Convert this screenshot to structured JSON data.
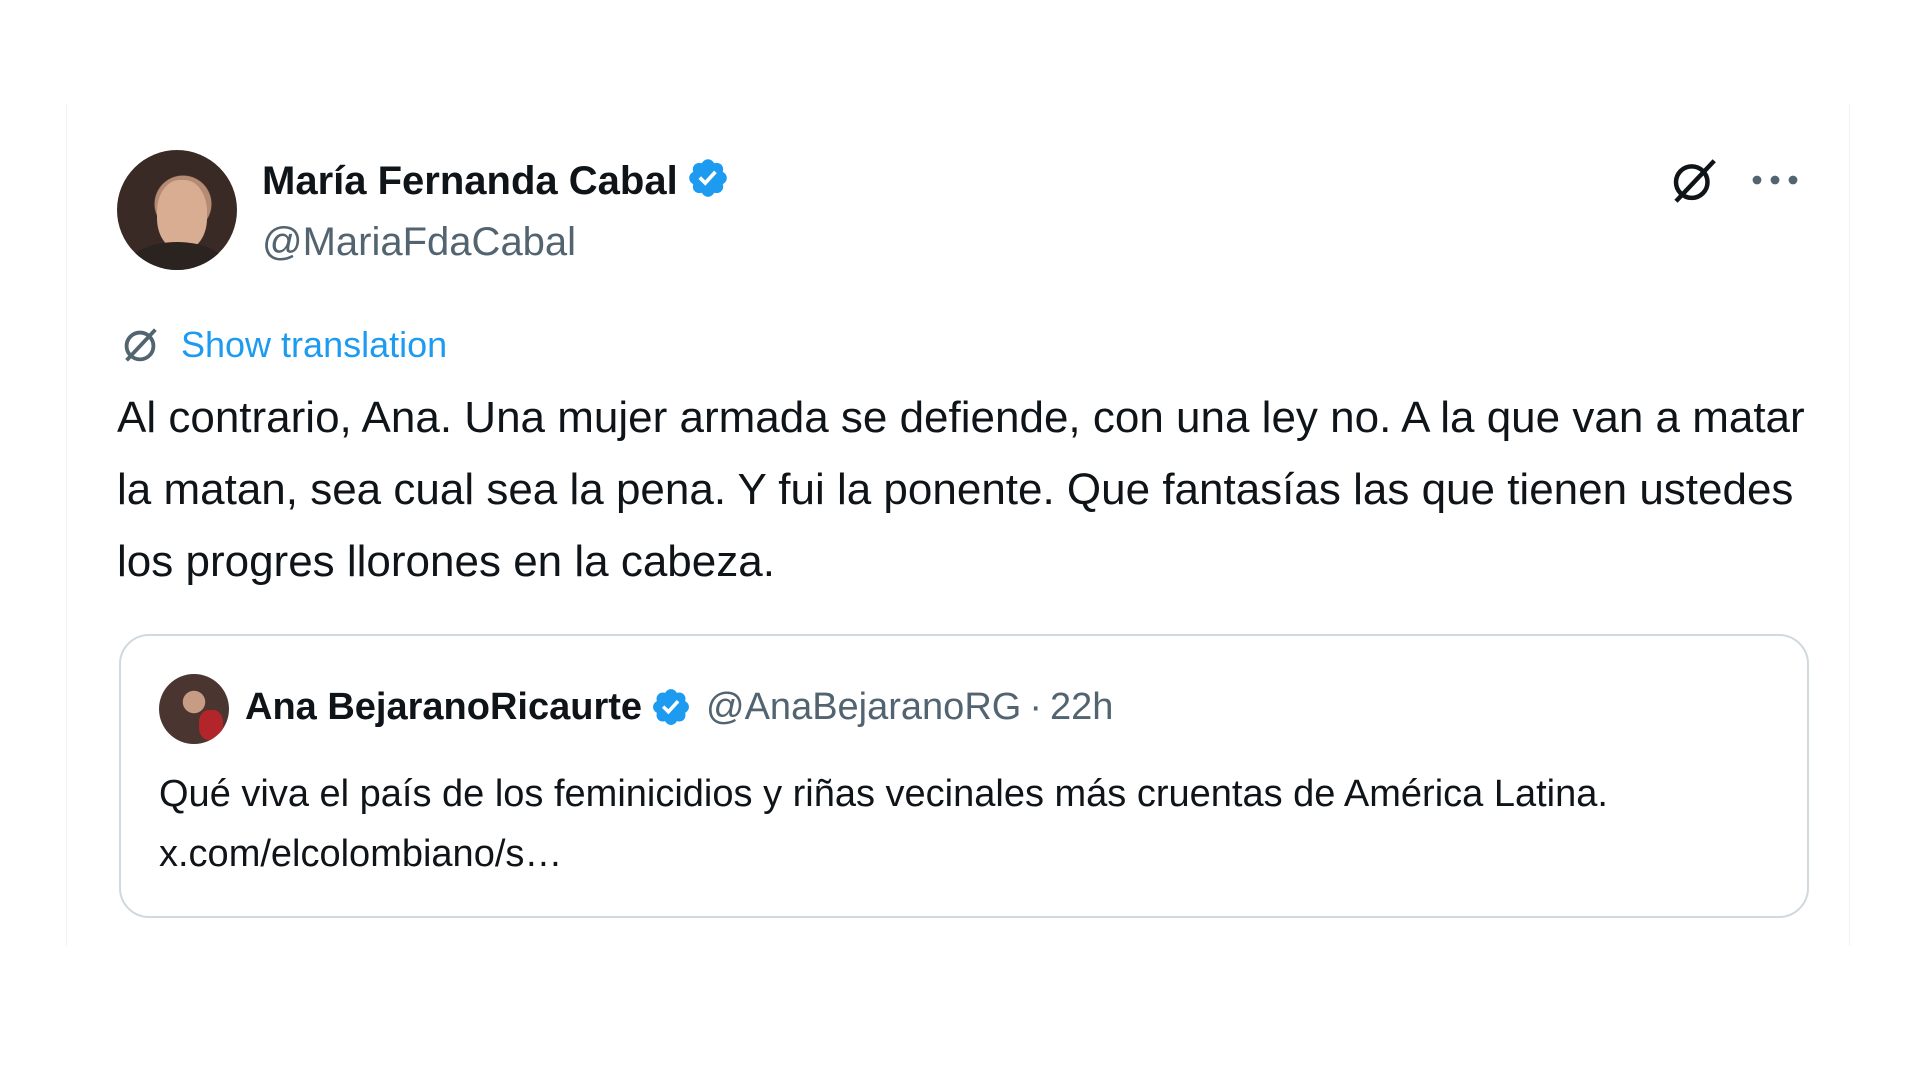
{
  "tweet": {
    "author": {
      "name": "María Fernanda Cabal",
      "handle": "@MariaFdaCabal",
      "verified": true
    },
    "translate_label": "Show translation",
    "text": "Al contrario, Ana. Una mujer armada se defiende, con una ley no. A la que van a matar la matan, sea cual sea la pena. Y fui la ponente. Que fantasías las que tienen ustedes los progres llorones en la cabeza."
  },
  "quote": {
    "author": {
      "name": "Ana BejaranoRicaurte",
      "handle": "@AnaBejaranoRG",
      "verified": true
    },
    "separator": "·",
    "time": "22h",
    "text": "Qué viva el país de los feminicidios y riñas vecinales más cruentas de América Latina. x.com/elcolombiano/s…"
  },
  "icons": {
    "verified": "verified-badge-icon",
    "grok": "grok-icon",
    "more": "more-horizontal-icon",
    "translate": "translate-icon"
  },
  "colors": {
    "accent": "#1d9bf0",
    "text": "#0f1419",
    "secondary": "#536471",
    "border": "#cfd9de"
  }
}
